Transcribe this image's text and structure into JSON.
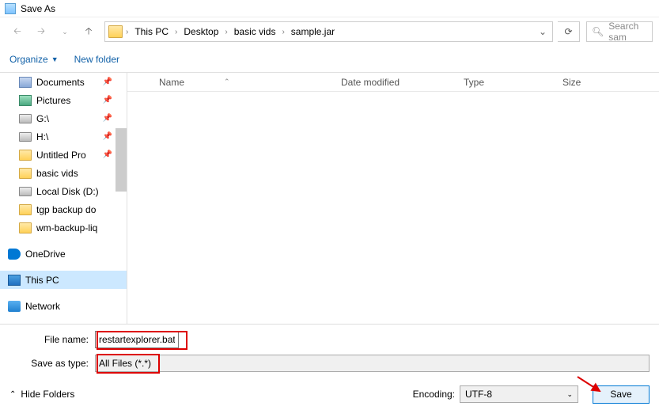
{
  "window": {
    "title": "Save As"
  },
  "nav": {
    "crumbs": [
      "This PC",
      "Desktop",
      "basic vids",
      "sample.jar"
    ],
    "search_placeholder": "Search sam"
  },
  "toolbar": {
    "organize": "Organize",
    "new_folder": "New folder"
  },
  "sidebar": {
    "items": [
      {
        "label": "Documents",
        "icon": "doc",
        "pinned": true
      },
      {
        "label": "Pictures",
        "icon": "pic",
        "pinned": true
      },
      {
        "label": "G:\\",
        "icon": "disk",
        "pinned": true
      },
      {
        "label": "H:\\",
        "icon": "disk",
        "pinned": true
      },
      {
        "label": "Untitled Pro",
        "icon": "folder",
        "pinned": true
      },
      {
        "label": "basic vids",
        "icon": "folder"
      },
      {
        "label": "Local Disk (D:)",
        "icon": "disk"
      },
      {
        "label": "tgp backup do",
        "icon": "folder"
      },
      {
        "label": "wm-backup-liq",
        "icon": "folder"
      }
    ],
    "onedrive": "OneDrive",
    "thispc": "This PC",
    "network": "Network"
  },
  "columns": {
    "name": "Name",
    "date": "Date modified",
    "type": "Type",
    "size": "Size"
  },
  "form": {
    "filename_label": "File name:",
    "filename_value": "restartexplorer.bat",
    "filetype_label": "Save as type:",
    "filetype_value": "All Files  (*.*)"
  },
  "footer": {
    "hide_folders": "Hide Folders",
    "encoding_label": "Encoding:",
    "encoding_value": "UTF-8",
    "save": "Save"
  }
}
